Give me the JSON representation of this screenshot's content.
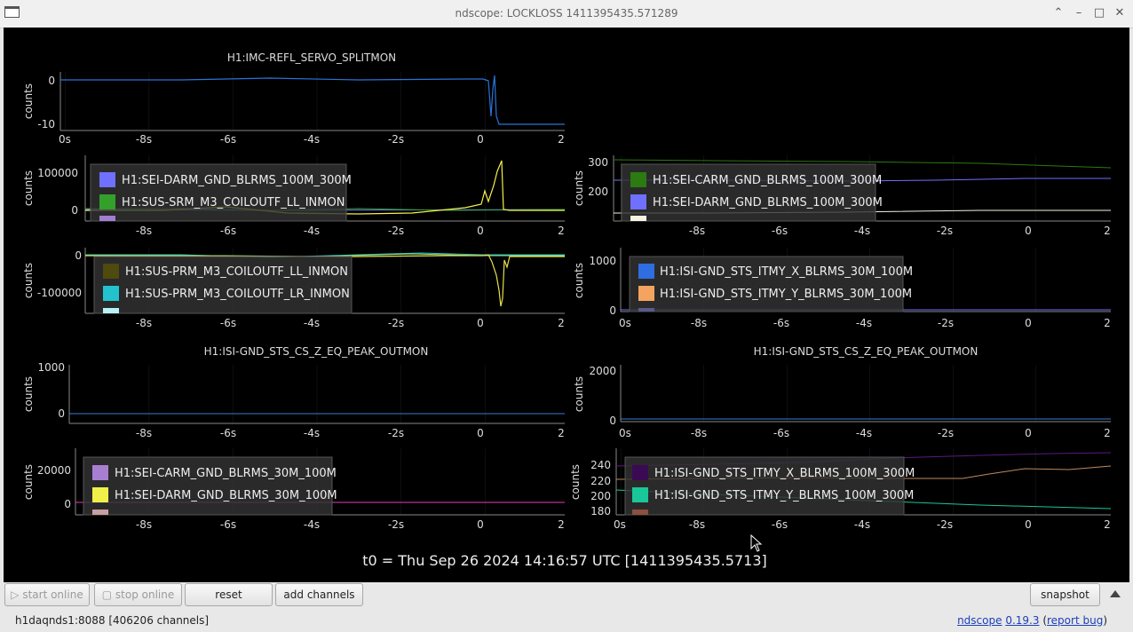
{
  "window": {
    "title": "ndscope: LOCKLOSS 1411395435.571289"
  },
  "colors": {
    "blue": "#2a74d8",
    "green": "#31a64b",
    "yellow": "#f5ef4a",
    "purple": "#7b7bff"
  },
  "plots": [
    {
      "title": "H1:IMC-REFL_SERVO_SPLITMON",
      "ylabel": "counts",
      "yticks": [
        "0",
        "-10"
      ],
      "xticks": [
        "0s",
        "-8s",
        "-6s",
        "-4s",
        "-2s",
        "0",
        "2"
      ],
      "legend": []
    },
    {
      "title": "",
      "ylabel": "counts",
      "yticks": [
        "100000",
        "0"
      ],
      "xticks": [
        "-8s",
        "-6s",
        "-4s",
        "-2s",
        "0",
        "2"
      ],
      "legend": [
        {
          "label": "H1:SEI-DARM_GND_BLRMS_100M_300M",
          "color": "#7070ff"
        },
        {
          "label": "H1:SUS-SRM_M3_COILOUTF_LL_INMON",
          "color": "#33a02c"
        }
      ]
    },
    {
      "title": "",
      "ylabel": "counts",
      "yticks": [
        "300",
        "200"
      ],
      "xticks": [
        "-8s",
        "-6s",
        "-4s",
        "-2s",
        "0",
        "2"
      ],
      "legend": [
        {
          "label": "H1:SEI-CARM_GND_BLRMS_100M_300M",
          "color": "#2b7a12"
        },
        {
          "label": "H1:SEI-DARM_GND_BLRMS_100M_300M",
          "color": "#7070ff"
        }
      ]
    },
    {
      "title": "",
      "ylabel": "counts",
      "yticks": [
        "0",
        "-100000"
      ],
      "xticks": [
        "-8s",
        "-6s",
        "-4s",
        "-2s",
        "0",
        "2"
      ],
      "legend": [
        {
          "label": "H1:SUS-PRM_M3_COILOUTF_LL_INMON",
          "color": "#4f4a0d"
        },
        {
          "label": "H1:SUS-PRM_M3_COILOUTF_LR_INMON",
          "color": "#22c3cf"
        }
      ]
    },
    {
      "title": "",
      "ylabel": "counts",
      "yticks": [
        "1000",
        "0"
      ],
      "xticks": [
        "0s",
        "-8s",
        "-6s",
        "-4s",
        "-2s",
        "0",
        "2"
      ],
      "legend": [
        {
          "label": "H1:ISI-GND_STS_ITMY_X_BLRMS_30M_100M",
          "color": "#2f6ee0"
        },
        {
          "label": "H1:ISI-GND_STS_ITMY_Y_BLRMS_30M_100M",
          "color": "#f4a460"
        }
      ]
    },
    {
      "title": "H1:ISI-GND_STS_CS_Z_EQ_PEAK_OUTMON",
      "ylabel": "counts",
      "yticks": [
        "1000",
        "0"
      ],
      "xticks": [
        "-8s",
        "-6s",
        "-4s",
        "-2s",
        "0",
        "2"
      ],
      "legend": []
    },
    {
      "title": "H1:ISI-GND_STS_CS_Z_EQ_PEAK_OUTMON",
      "ylabel": "counts",
      "yticks": [
        "2000",
        "0"
      ],
      "xticks": [
        "0s",
        "-8s",
        "-6s",
        "-4s",
        "-2s",
        "0",
        "2"
      ],
      "legend": []
    },
    {
      "title": "",
      "ylabel": "counts",
      "yticks": [
        "20000",
        "0"
      ],
      "xticks": [
        "-8s",
        "-6s",
        "-4s",
        "-2s",
        "0",
        "2"
      ],
      "legend": [
        {
          "label": "H1:SEI-CARM_GND_BLRMS_30M_100M",
          "color": "#a87fd0"
        },
        {
          "label": "H1:SEI-DARM_GND_BLRMS_30M_100M",
          "color": "#f0ef4a"
        }
      ]
    },
    {
      "title": "",
      "ylabel": "counts",
      "yticks": [
        "240",
        "220",
        "200",
        "180"
      ],
      "xticks": [
        "0s",
        "-8s",
        "-6s",
        "-4s",
        "-2s",
        "0",
        "2"
      ],
      "legend": [
        {
          "label": "H1:ISI-GND_STS_ITMY_X_BLRMS_100M_300M",
          "color": "#3b0a55"
        },
        {
          "label": "H1:ISI-GND_STS_ITMY_Y_BLRMS_100M_300M",
          "color": "#19c79a"
        }
      ]
    }
  ],
  "t0_label": "t0 = Thu Sep 26 2024 14:16:57 UTC [1411395435.5713]",
  "toolbar": {
    "start_online": "start online",
    "stop_online": "stop online",
    "reset": "reset",
    "add_channels": "add channels",
    "snapshot": "snapshot"
  },
  "status": {
    "server": "h1daqnds1:8088  [406206 channels]",
    "app_name": "ndscope",
    "version": "0.19.3",
    "report_bug": "report bug"
  }
}
